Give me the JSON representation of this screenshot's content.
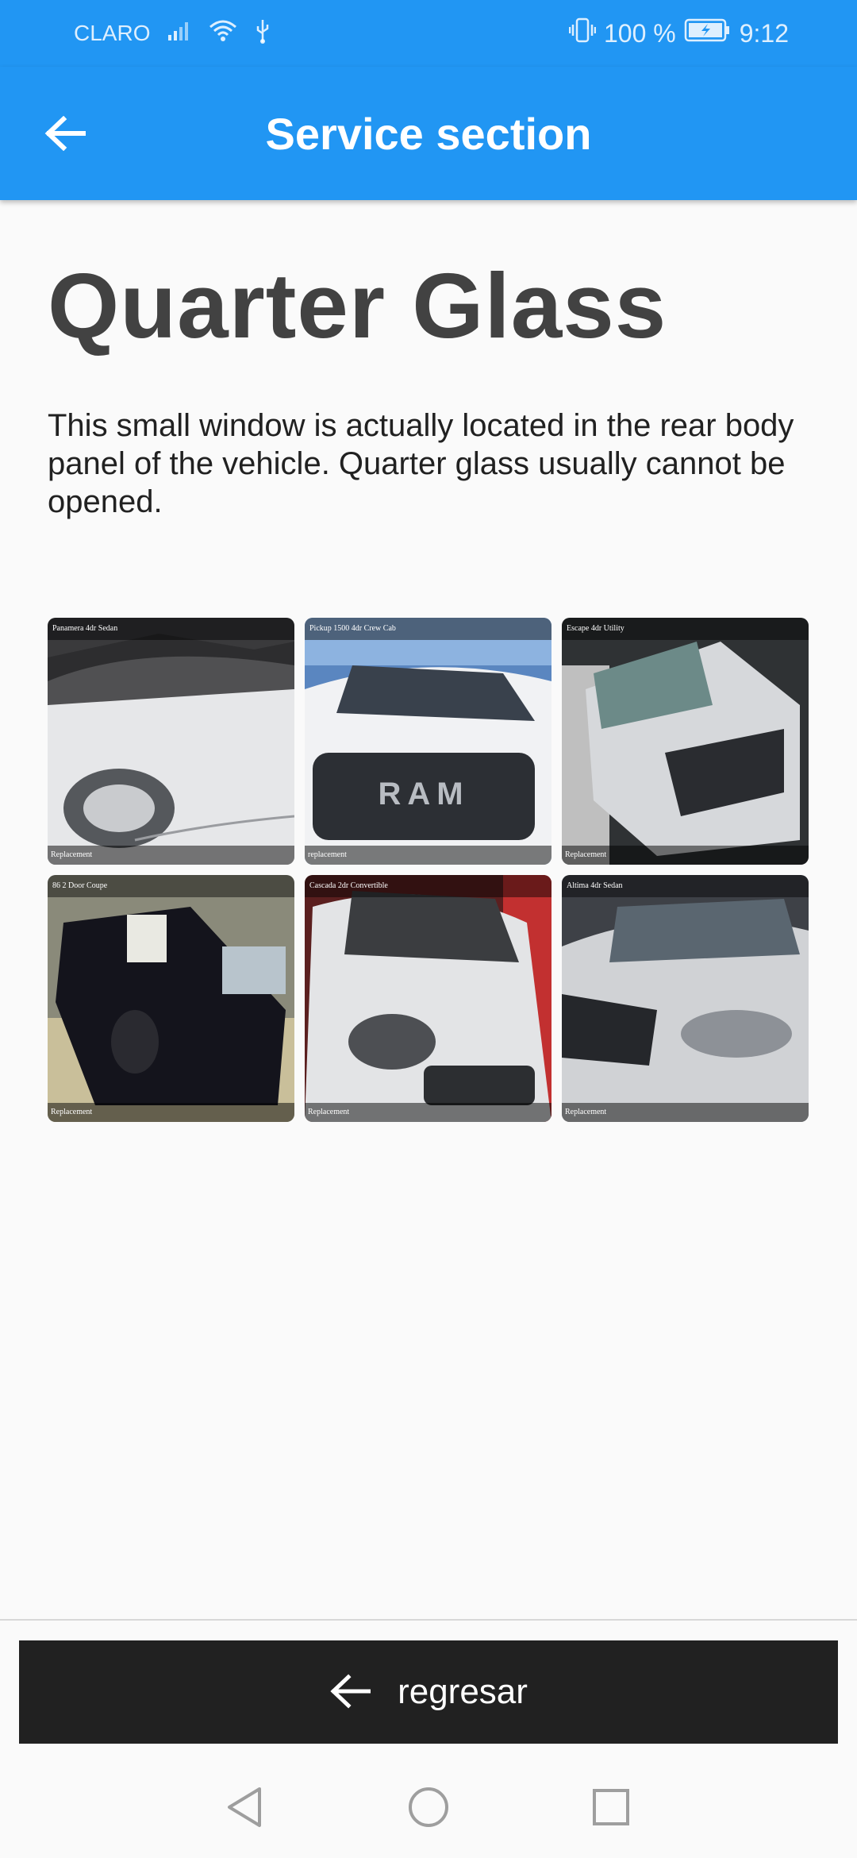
{
  "status_bar": {
    "carrier": "CLARO",
    "battery": "100 %",
    "time": "9:12"
  },
  "app_bar": {
    "title": "Service section"
  },
  "content": {
    "title": "Quarter Glass",
    "description": "This small window is actually located in the rear body panel of the vehicle. Quarter glass usually cannot be opened."
  },
  "gallery": [
    {
      "caption": "Panamera 4dr Sedan",
      "label": "Replacement",
      "car_color": "#e6e7e9",
      "bg_color": "#3a3a3c"
    },
    {
      "caption": "Pickup 1500 4dr Crew Cab",
      "label": "replacement",
      "car_color": "#f1f2f4",
      "bg_color": "#5a86c0"
    },
    {
      "caption": "Escape 4dr Utility",
      "label": "Replacement",
      "car_color": "#d6d8db",
      "bg_color": "#2f3234"
    },
    {
      "caption": "86 2 Door Coupe",
      "label": "Replacement",
      "car_color": "#14141c",
      "bg_color": "#8a8a7a"
    },
    {
      "caption": "Cascada 2dr Convertible",
      "label": "Replacement",
      "car_color": "#e3e4e6",
      "bg_color": "#5b1f1f"
    },
    {
      "caption": "Altima 4dr Sedan",
      "label": "Replacement",
      "car_color": "#d0d2d5",
      "bg_color": "#3e4147"
    }
  ],
  "bottom_button": {
    "label": "regresar"
  },
  "colors": {
    "primary": "#2196f3",
    "button_bg": "#212121",
    "title_text": "#424242"
  }
}
